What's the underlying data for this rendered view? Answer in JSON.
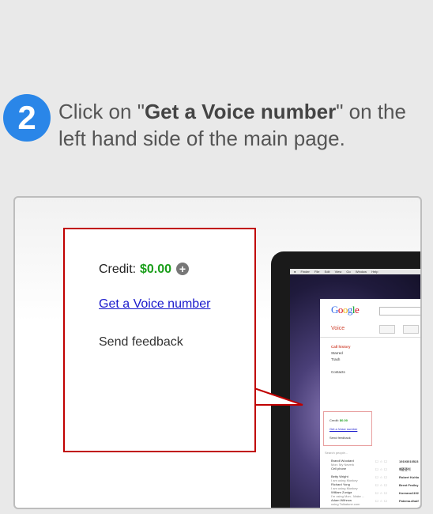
{
  "step": {
    "number": "2",
    "text_before": "Click on \"",
    "text_bold": "Get a Voice number",
    "text_after": "\" on the left hand side of the main page."
  },
  "callout": {
    "credit_label": "Credit:",
    "credit_value": "$0.00",
    "add_icon": "plus-circle-icon",
    "link_label": "Get a Voice number",
    "feedback_label": "Send feedback",
    "border_color": "#c00000"
  },
  "screenshot": {
    "menubar": [
      "Finder",
      "File",
      "Edit",
      "View",
      "Go",
      "Window",
      "Help"
    ],
    "logo": "Google",
    "app_title": "Voice",
    "nav": {
      "call_history": "Call history",
      "starred": "Starred",
      "trash": "Trash",
      "contacts": "Contacts"
    },
    "mini_popup": {
      "credit_label": "Credit:",
      "credit_value": "$0.00",
      "link_label": "Get a Voice number",
      "feedback_label": "Send feedback"
    },
    "search_placeholder": "Search people...",
    "contacts": [
      {
        "name": "Brandi Woodard",
        "status": "Mon: My Neverk",
        "number": "19193010523"
      },
      {
        "name": "Cell phone",
        "status": "",
        "number": "예준준이"
      },
      {
        "name": "Betty Wright",
        "status": "I am using Monkey",
        "number": "Robert Kohlo"
      },
      {
        "name": "Richard Yong",
        "status": "I am using Monkey",
        "number": "Brent Frailey"
      },
      {
        "name": "William Zuniga",
        "status": "I'm using Mon.. Make ...",
        "number": "Koreano1102"
      },
      {
        "name": "Adam Withrow",
        "status": "using Talkatone.com",
        "number": "Fatema.dhaif"
      }
    ]
  }
}
